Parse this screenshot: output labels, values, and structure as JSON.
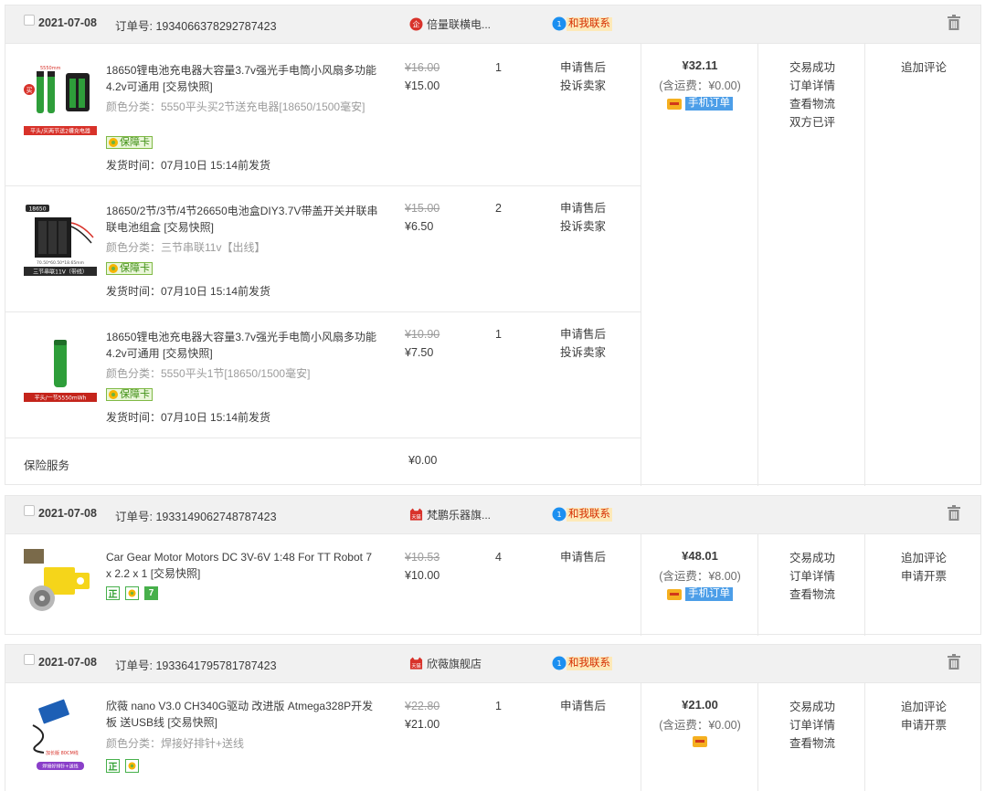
{
  "orders": [
    {
      "date": "2021-07-08",
      "order_label": "订单号: 1934066378292787423",
      "shop": "倍量联横电...",
      "contact": "和我联系",
      "items": [
        {
          "title": "18650锂电池充电器大容量3.7v强光手电筒小风扇多功能4.2v可通用 [交易快照]",
          "attr": "颜色分类：5550平头买2节送充电器[18650/1500毫安]",
          "badge": "保障卡",
          "ship": "发货时间：07月10日 15:14前发货",
          "price_old": "¥16.00",
          "price_new": "¥15.00",
          "qty": "1",
          "after": [
            "申请售后",
            "投诉卖家"
          ],
          "thumb_caption": "平头/买两节送2槽充电器",
          "thumb_top_label": "5550mm",
          "thumb_side_label": "买"
        },
        {
          "title": "18650/2节/3节/4节26650电池盒DIY3.7V带盖开关并联串联电池组盒 [交易快照]",
          "attr": "颜色分类：三节串联11v【出线】",
          "badge": "保障卡",
          "ship": "发货时间：07月10日 15:14前发货",
          "price_old": "¥15.00",
          "price_new": "¥6.50",
          "qty": "2",
          "after": [
            "申请售后",
            "投诉卖家"
          ],
          "thumb_caption": "三节串联11V（带线）",
          "thumb_top_label": "18650",
          "thumb_dims": "70.50*60.50*18.65mm"
        },
        {
          "title": "18650锂电池充电器大容量3.7v强光手电筒小风扇多功能4.2v可通用 [交易快照]",
          "attr": "颜色分类：5550平头1节[18650/1500毫安]",
          "badge": "保障卡",
          "ship": "发货时间：07月10日 15:14前发货",
          "price_old": "¥10.90",
          "price_new": "¥7.50",
          "qty": "1",
          "after": [
            "申请售后",
            "投诉卖家"
          ],
          "thumb_caption": "平头/一节5550mWh"
        }
      ],
      "service_label": "保险服务",
      "service_price": "¥0.00",
      "total": "¥32.11",
      "shipping": "(含运费：¥0.00)",
      "mobile_tag": "手机订单",
      "status": [
        "交易成功",
        "订单详情",
        "查看物流",
        "双方已评"
      ],
      "ops": [
        "追加评论"
      ]
    },
    {
      "date": "2021-07-08",
      "order_label": "订单号: 1933149062748787423",
      "shop": "梵鹏乐器旗...",
      "shop_icon_text": "天猫",
      "contact": "和我联系",
      "items": [
        {
          "title": "Car Gear Motor Motors DC 3V-6V 1:48 For TT Robot 7 x 2.2 x 1 [交易快照]",
          "price_old": "¥10.53",
          "price_new": "¥10.00",
          "qty": "4",
          "after": [
            "申请售后"
          ],
          "icons": [
            "正",
            "7"
          ]
        }
      ],
      "total": "¥48.01",
      "shipping": "(含运费：¥8.00)",
      "mobile_tag": "手机订单",
      "status": [
        "交易成功",
        "订单详情",
        "查看物流"
      ],
      "ops": [
        "追加评论",
        "申请开票"
      ]
    },
    {
      "date": "2021-07-08",
      "order_label": "订单号: 1933641795781787423",
      "shop": "欣薇旗舰店",
      "shop_icon_text": "天猫",
      "contact": "和我联系",
      "items": [
        {
          "title": "欣薇 nano V3.0 CH340G驱动 改进版 Atmega328P开发板 送USB线 [交易快照]",
          "attr": "颜色分类：焊接好排针+送线",
          "price_old": "¥22.80",
          "price_new": "¥21.00",
          "qty": "1",
          "after": [
            "申请售后"
          ],
          "icons": [
            "正"
          ],
          "thumb_caption": "焊接好排针+送线",
          "thumb_label": "加长版 80CM线"
        }
      ],
      "total": "¥21.00",
      "shipping": "(含运费：¥0.00)",
      "status": [
        "交易成功",
        "订单详情",
        "查看物流"
      ],
      "ops": [
        "追加评论",
        "申请开票"
      ]
    }
  ]
}
